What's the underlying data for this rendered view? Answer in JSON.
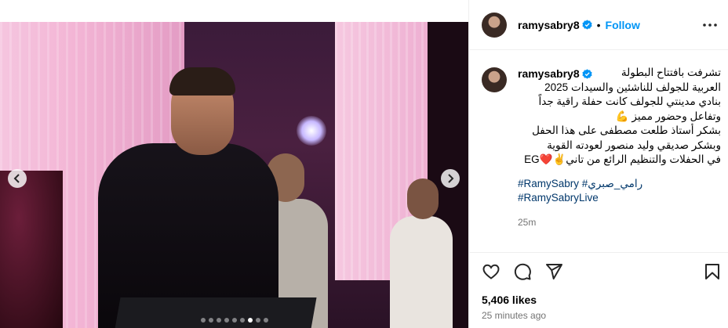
{
  "post": {
    "username": "ramysabry8",
    "follow_label": "Follow",
    "separator": "•",
    "caption_lines": [
      "تشرفت بافتتاح البطولة",
      "العربية للجولف للناشئين والسيدات 2025",
      "بنادي مدينتي للجولف كانت حفلة راقية جداً",
      "وتفاعل وحضور مميز 💪",
      "بشكر أستاذ طلعت مصطفى على هذا الحفل",
      "وبشكر صديقي وليد منصور لعودته القوية",
      "في الحفلات والتنظيم الرائع من تاني✌️❤️EG"
    ],
    "hashtags_line1": "#RamySabry #رامي_صبري",
    "hashtags_line2": "#RamySabryLive",
    "time_short": "25m",
    "likes": "5,406 likes",
    "time_long": "25 minutes ago"
  },
  "carousel": {
    "total_dots": 9,
    "active_dot": 6
  },
  "icons": {
    "verified": "verified-badge-icon",
    "more": "more-options-icon",
    "like": "heart-icon",
    "comment": "comment-icon",
    "share": "share-icon",
    "save": "bookmark-icon",
    "prev": "chevron-left-icon",
    "next": "chevron-right-icon"
  },
  "colors": {
    "accent": "#0095f6",
    "hashtag": "#00376b",
    "muted": "#737373"
  }
}
